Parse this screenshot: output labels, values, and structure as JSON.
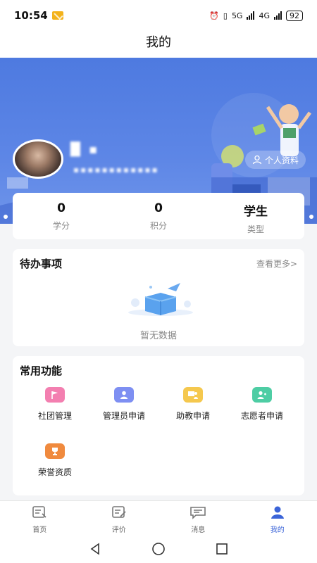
{
  "status": {
    "time": "10:54",
    "battery": "92",
    "net1": "5G",
    "net2": "4G"
  },
  "title": "我的",
  "profile": {
    "name": "█ ▪",
    "subtitle": "▪▪▪▪▪▪▪▪▪▪▪▪",
    "button": "个人资料"
  },
  "stats": [
    {
      "value": "0",
      "label": "学分"
    },
    {
      "value": "0",
      "label": "积分"
    },
    {
      "value": "学生",
      "label": "类型"
    }
  ],
  "todo": {
    "title": "待办事项",
    "more": "查看更多>",
    "empty": "暂无数据"
  },
  "functions": {
    "title": "常用功能",
    "items": [
      {
        "label": "社团管理",
        "color": "#f37fb0",
        "icon": "flag-icon"
      },
      {
        "label": "管理员申请",
        "color": "#7e8ff2",
        "icon": "user-icon"
      },
      {
        "label": "助教申请",
        "color": "#f5c84e",
        "icon": "teacher-icon"
      },
      {
        "label": "志愿者申请",
        "color": "#4ecda4",
        "icon": "volunteer-icon"
      },
      {
        "label": "荣誉资质",
        "color": "#f08a3e",
        "icon": "trophy-icon"
      }
    ]
  },
  "tabs": [
    {
      "label": "首页"
    },
    {
      "label": "评价"
    },
    {
      "label": "消息"
    },
    {
      "label": "我的",
      "active": true
    }
  ]
}
